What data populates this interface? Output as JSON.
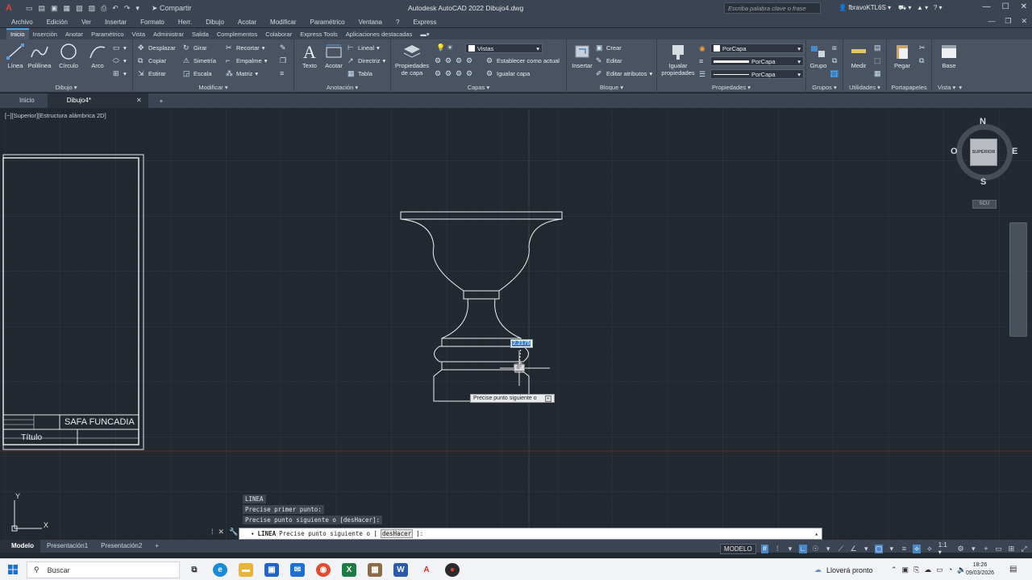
{
  "titlebar": {
    "app_logo": "A",
    "share_label": "Compartir",
    "title": "Autodesk AutoCAD 2022   Dibujo4.dwg",
    "search_placeholder": "Escriba palabra clave o frase",
    "user": "fbravoKTL6S"
  },
  "menubar": [
    "Archivo",
    "Edición",
    "Ver",
    "Insertar",
    "Formato",
    "Herr.",
    "Dibujo",
    "Acotar",
    "Modificar",
    "Paramétrico",
    "Ventana",
    "?",
    "Express"
  ],
  "ribbon_tabs": [
    "Inicio",
    "Inserción",
    "Anotar",
    "Paramétrico",
    "Vista",
    "Administrar",
    "Salida",
    "Complementos",
    "Colaborar",
    "Express Tools",
    "Aplicaciones destacadas"
  ],
  "ribbon": {
    "dibujo": {
      "title": "Dibujo",
      "linea": "Línea",
      "polilinea": "Polilínea",
      "circulo": "Círculo",
      "arco": "Arco"
    },
    "modificar": {
      "title": "Modificar",
      "desplazar": "Desplazar",
      "girar": "Girar",
      "recortar": "Recortar",
      "copiar": "Copiar",
      "simetria": "Simetría",
      "empalme": "Empalme",
      "estirar": "Estirar",
      "escala": "Escala",
      "matriz": "Matriz"
    },
    "anotacion": {
      "title": "Anotación",
      "texto": "Texto",
      "acotar": "Acotar",
      "lineal": "Lineal",
      "directriz": "Directriz",
      "tabla": "Tabla"
    },
    "capas": {
      "title": "Capas",
      "propiedades": "Propiedades de capa",
      "vistas": "Vistas",
      "establecer": "Establecer como actual",
      "igualar": "Igualar capa"
    },
    "bloque": {
      "title": "Bloque",
      "insertar": "Insertar",
      "crear": "Crear",
      "editar": "Editar",
      "editar_atributos": "Editar atributos"
    },
    "propiedades": {
      "title": "Propiedades",
      "igualar": "Igualar propiedades",
      "color": "PorCapa",
      "tipo_linea": "PorCapa",
      "grosor": "PorCapa"
    },
    "grupos": {
      "title": "Grupos",
      "grupo": "Grupo"
    },
    "utilidades": {
      "title": "Utilidades",
      "medir": "Medir"
    },
    "portapapeles": {
      "title": "Portapapeles",
      "pegar": "Pegar"
    },
    "vista": {
      "title": "Vista",
      "base": "Base"
    }
  },
  "filetabs": {
    "start": "Inicio",
    "drawing": "Dibujo4*"
  },
  "viewport_label": "[−][Superior][Estructura alámbrica 2D]",
  "drawing": {
    "title_block_name": "SAFA FUNCADIA",
    "title_label": "Título",
    "dimension_input": "2.2175",
    "angle_input": "0°",
    "tooltip": "Precise punto siguiente o"
  },
  "navcube": {
    "north": "N",
    "south": "S",
    "east": "E",
    "west": "O",
    "face": "SUPERIOR",
    "ucs": "SCU"
  },
  "ucs_icon": {
    "x": "X",
    "y": "Y"
  },
  "command_history": [
    "LINEA",
    "Precise primer punto:",
    "Precise punto siguiente o [desHacer]:"
  ],
  "command_line": {
    "cmd": "LINEA",
    "prompt": "Precise punto siguiente o [",
    "option": "desHacer",
    "suffix": "]:"
  },
  "layout_tabs": [
    "Modelo",
    "Presentación1",
    "Presentación2"
  ],
  "status": {
    "model": "MODELO",
    "scale": "1:1"
  },
  "taskbar": {
    "search": "Buscar",
    "weather": "Lloverá pronto",
    "time": "18:26",
    "date": "09/03/2026"
  },
  "colors": {
    "accent": "#4ea3e5",
    "canvas": "#212830",
    "ribbon": "#4a5362"
  }
}
